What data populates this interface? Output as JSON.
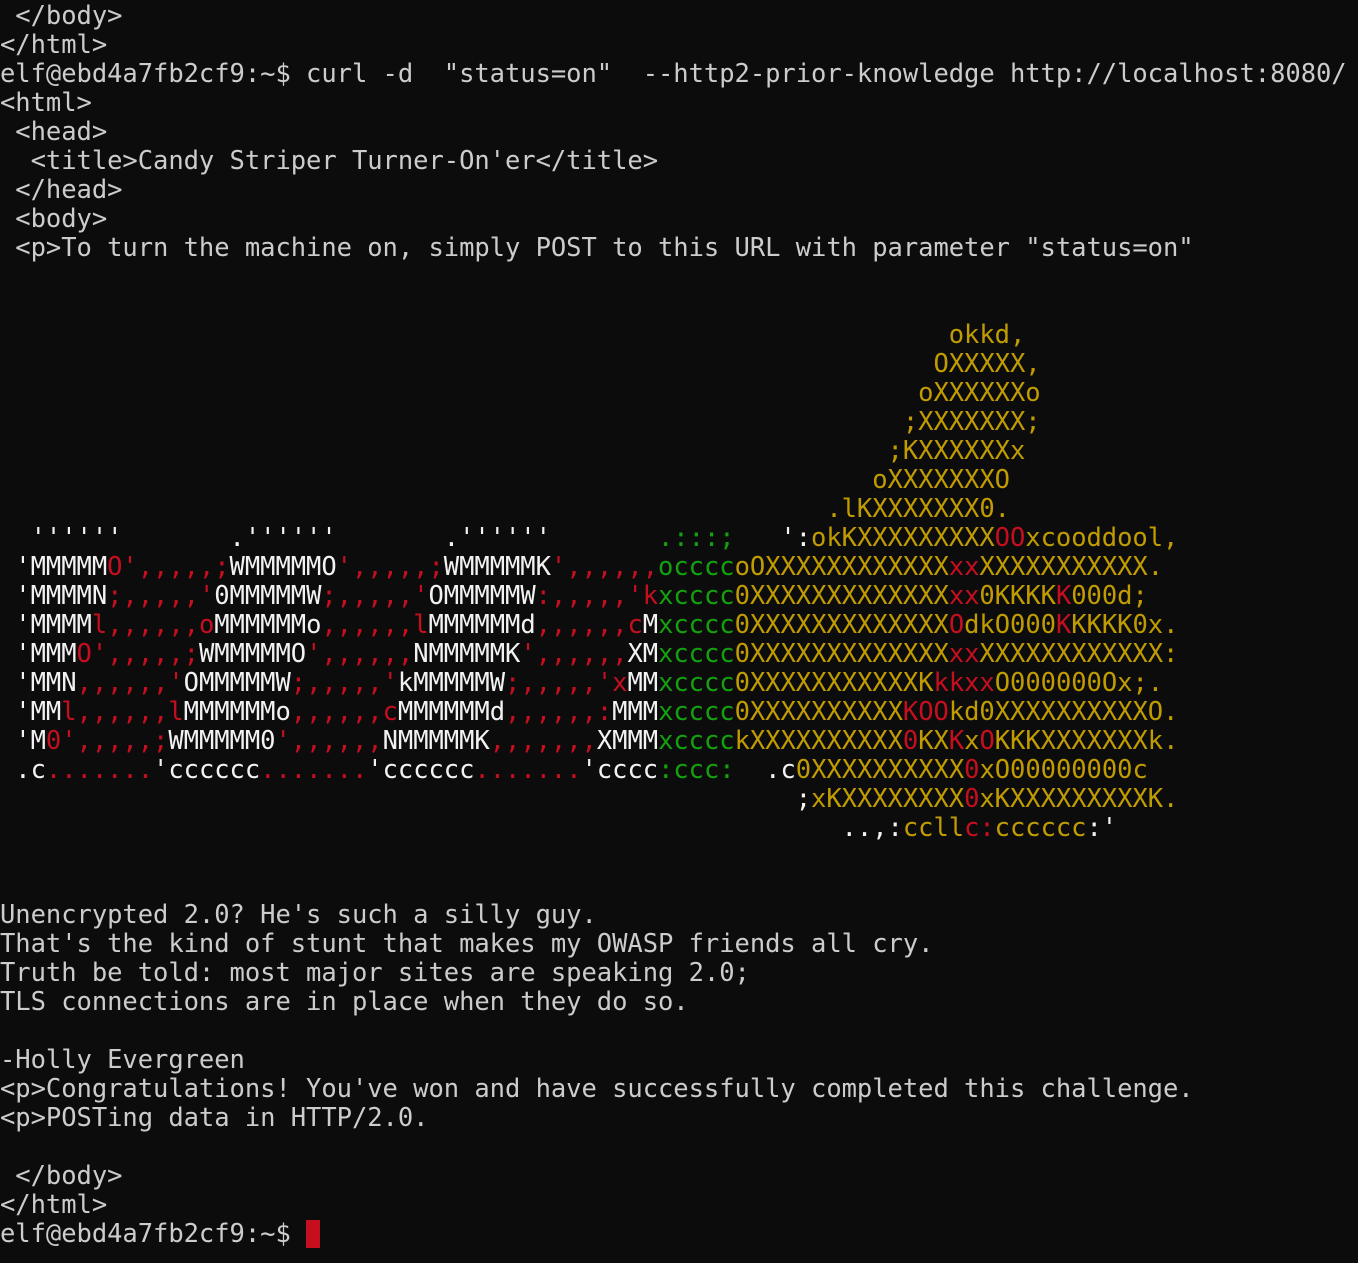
{
  "terminal": {
    "colors": {
      "background": "#0c0c0c",
      "default": "#cccccc",
      "white": "#f2f2f2",
      "red": "#c50f1f",
      "yellow": "#c19c00",
      "green": "#13a10e",
      "cursor": "#c50f1f"
    },
    "lines": [
      {
        "segs": [
          [
            " </body>",
            "d"
          ]
        ]
      },
      {
        "segs": [
          [
            "</html>",
            "d"
          ]
        ]
      },
      {
        "segs": [
          [
            "elf@ebd4a7fb2cf9:~$ curl -d  \"status=on\"  --http2-prior-knowledge http://localhost:8080/",
            "d"
          ]
        ]
      },
      {
        "segs": [
          [
            "<html>",
            "d"
          ]
        ]
      },
      {
        "segs": [
          [
            " <head>",
            "d"
          ]
        ]
      },
      {
        "segs": [
          [
            "  <title>Candy Striper Turner-On'er</title>",
            "d"
          ]
        ]
      },
      {
        "segs": [
          [
            " </head>",
            "d"
          ]
        ]
      },
      {
        "segs": [
          [
            " <body>",
            "d"
          ]
        ]
      },
      {
        "segs": [
          [
            " <p>To turn the machine on, simply POST to this URL with parameter \"status=on\"",
            "d"
          ]
        ]
      },
      {
        "segs": []
      },
      {
        "segs": []
      },
      {
        "segs": [
          [
            "                                                              okkd,",
            "y"
          ]
        ]
      },
      {
        "segs": [
          [
            "                                                             OXXXXX,",
            "y"
          ]
        ]
      },
      {
        "segs": [
          [
            "                                                            oXXXXXXo",
            "y"
          ]
        ]
      },
      {
        "segs": [
          [
            "                                                           ;XXXXXXX;",
            "y"
          ]
        ]
      },
      {
        "segs": [
          [
            "                                                          ;KXXXXXXx",
            "y"
          ]
        ]
      },
      {
        "segs": [
          [
            "                                                         oXXXXXXXO",
            "y"
          ]
        ]
      },
      {
        "segs": [
          [
            "                                                      .lKXXXXXXX0.",
            "y"
          ]
        ]
      },
      {
        "segs": [
          [
            "  ''''''       .''''''       .''''''       ",
            "w"
          ],
          [
            ".:::;",
            "g"
          ],
          [
            "   ':",
            "w"
          ],
          [
            "okKXXXXXXXXX",
            "y"
          ],
          [
            "OO",
            "r"
          ],
          [
            "x",
            "y"
          ],
          [
            "cooddool,",
            "y"
          ]
        ]
      },
      {
        "segs": [
          [
            " 'MMMMM",
            "w"
          ],
          [
            "O',,,,,;",
            "r"
          ],
          [
            "WMMMMMO",
            "w"
          ],
          [
            "',,,,,;",
            "r"
          ],
          [
            "WMMMMMK",
            "w"
          ],
          [
            "',,,,,,",
            "r"
          ],
          [
            "occcc",
            "g"
          ],
          [
            "oOXXXXXXXXXXXX",
            "y"
          ],
          [
            "xx",
            "r"
          ],
          [
            "XXXXXXXXXXX.",
            "y"
          ]
        ]
      },
      {
        "segs": [
          [
            " 'MMMMN",
            "w"
          ],
          [
            ";,,,,,'",
            "r"
          ],
          [
            "0MMMMMW",
            "w"
          ],
          [
            ";,,,,,'",
            "r"
          ],
          [
            "OMMMMMW",
            "w"
          ],
          [
            ":,,,,,'",
            "r"
          ],
          [
            "k",
            "r"
          ],
          [
            "xcccc",
            "g"
          ],
          [
            "0XXXXXXXXXXXXX",
            "y"
          ],
          [
            "xx",
            "r"
          ],
          [
            "0KKKK",
            "y"
          ],
          [
            "K",
            "r"
          ],
          [
            "000d;",
            "y"
          ]
        ]
      },
      {
        "segs": [
          [
            " 'MMMM",
            "w"
          ],
          [
            "l,,,,,,o",
            "r"
          ],
          [
            "MMMMMMo",
            "w"
          ],
          [
            ",,,,,,l",
            "r"
          ],
          [
            "MMMMMMd",
            "w"
          ],
          [
            ",,,,,,c",
            "r"
          ],
          [
            "M",
            "w"
          ],
          [
            "xcccc",
            "g"
          ],
          [
            "0XXXXXXXXXXXXX",
            "y"
          ],
          [
            "O",
            "r"
          ],
          [
            "dkO000",
            "y"
          ],
          [
            "K",
            "r"
          ],
          [
            "KKKK0x.",
            "y"
          ]
        ]
      },
      {
        "segs": [
          [
            " 'MMM",
            "w"
          ],
          [
            "O',,,,,;",
            "r"
          ],
          [
            "WMMMMMO",
            "w"
          ],
          [
            "',,,,,,",
            "r"
          ],
          [
            "NMMMMMK",
            "w"
          ],
          [
            "',,,,,,",
            "r"
          ],
          [
            "XM",
            "w"
          ],
          [
            "xcccc",
            "g"
          ],
          [
            "0XXXXXXXXXXXXX",
            "y"
          ],
          [
            "xx",
            "r"
          ],
          [
            "XXXXXXXXXXXX:",
            "y"
          ]
        ]
      },
      {
        "segs": [
          [
            " 'MMN",
            "w"
          ],
          [
            ",,,,,,'",
            "r"
          ],
          [
            "OMMMMMW",
            "w"
          ],
          [
            ";,,,,,'",
            "r"
          ],
          [
            "kMMMMMW",
            "w"
          ],
          [
            ";,,,,,'",
            "r"
          ],
          [
            "x",
            "r"
          ],
          [
            "MM",
            "w"
          ],
          [
            "xcccc",
            "g"
          ],
          [
            "0XXXXXXXXXXXK",
            "y"
          ],
          [
            "kkxx",
            "r"
          ],
          [
            "O000000Ox;.",
            "y"
          ]
        ]
      },
      {
        "segs": [
          [
            " 'MM",
            "w"
          ],
          [
            "l,,,,,,l",
            "r"
          ],
          [
            "MMMMMMo",
            "w"
          ],
          [
            ",,,,,,c",
            "r"
          ],
          [
            "MMMMMMd",
            "w"
          ],
          [
            ",,,,,,:",
            "r"
          ],
          [
            "MMM",
            "w"
          ],
          [
            "xcccc",
            "g"
          ],
          [
            "0XXXXXXXXXX",
            "y"
          ],
          [
            "KOO",
            "r"
          ],
          [
            "kd0XXXXXXXXXXO.",
            "y"
          ]
        ]
      },
      {
        "segs": [
          [
            " 'M",
            "w"
          ],
          [
            "0',,,,,;",
            "r"
          ],
          [
            "WMMMMM0",
            "w"
          ],
          [
            "',,,,,,",
            "r"
          ],
          [
            "NMMMMMK",
            "w"
          ],
          [
            ",,,,,,,",
            "r"
          ],
          [
            "XMMM",
            "w"
          ],
          [
            "xcccc",
            "g"
          ],
          [
            "kXXXXXXXXXX",
            "y"
          ],
          [
            "0",
            "r"
          ],
          [
            "KX",
            "y"
          ],
          [
            "K",
            "r"
          ],
          [
            "x",
            "y"
          ],
          [
            "O",
            "r"
          ],
          [
            "KKKXXXXXXXk.",
            "y"
          ]
        ]
      },
      {
        "segs": [
          [
            " .c",
            "w"
          ],
          [
            ".......",
            "r"
          ],
          [
            "'cccccc",
            "w"
          ],
          [
            ".......",
            "r"
          ],
          [
            "'cccccc",
            "w"
          ],
          [
            ".......",
            "r"
          ],
          [
            "'cccc",
            "w"
          ],
          [
            ":ccc:",
            "g"
          ],
          [
            "  .c",
            "w"
          ],
          [
            "0XXXXXXXXXX",
            "y"
          ],
          [
            "0",
            "r"
          ],
          [
            "xO00000000c",
            "y"
          ]
        ]
      },
      {
        "segs": [
          [
            "                                                    ;",
            "w"
          ],
          [
            "xKXXXXXXXX",
            "y"
          ],
          [
            "0",
            "r"
          ],
          [
            "xKXXXXXXXXXK.",
            "y"
          ]
        ]
      },
      {
        "segs": [
          [
            "                                                       ..,:",
            "w"
          ],
          [
            "ccll",
            "y"
          ],
          [
            "c:",
            "r"
          ],
          [
            "cccccc",
            "y"
          ],
          [
            ":'",
            "w"
          ]
        ]
      },
      {
        "segs": []
      },
      {
        "segs": []
      },
      {
        "segs": [
          [
            "Unencrypted 2.0? He's such a silly guy.",
            "d"
          ]
        ]
      },
      {
        "segs": [
          [
            "That's the kind of stunt that makes my OWASP friends all cry.",
            "d"
          ]
        ]
      },
      {
        "segs": [
          [
            "Truth be told: most major sites are speaking 2.0;",
            "d"
          ]
        ]
      },
      {
        "segs": [
          [
            "TLS connections are in place when they do so.",
            "d"
          ]
        ]
      },
      {
        "segs": []
      },
      {
        "segs": [
          [
            "-Holly Evergreen",
            "d"
          ]
        ]
      },
      {
        "segs": [
          [
            "<p>Congratulations! You've won and have successfully completed this challenge.",
            "d"
          ]
        ]
      },
      {
        "segs": [
          [
            "<p>POSTing data in HTTP/2.0.",
            "d"
          ]
        ]
      },
      {
        "segs": []
      },
      {
        "segs": [
          [
            " </body>",
            "d"
          ]
        ]
      },
      {
        "segs": [
          [
            "</html>",
            "d"
          ]
        ]
      },
      {
        "segs": [
          [
            "elf@ebd4a7fb2cf9:~$ ",
            "d"
          ]
        ],
        "cursor": true
      }
    ]
  }
}
